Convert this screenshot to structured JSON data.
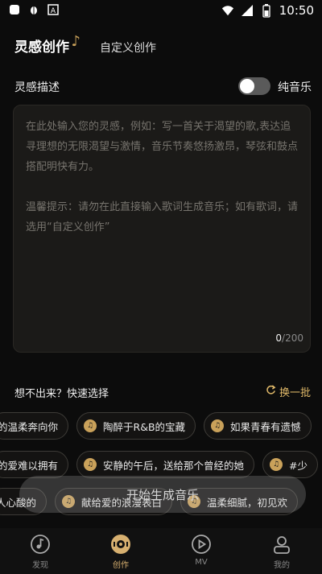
{
  "status_bar": {
    "time": "10:50",
    "left_icons": [
      "app-icon",
      "bug-icon",
      "font-icon"
    ],
    "right_icons": [
      "wifi-icon",
      "signal-icon",
      "battery-icon"
    ]
  },
  "tabs": {
    "active": "灵感创作",
    "inactive": "自定义创作"
  },
  "description": {
    "label": "灵感描述",
    "toggle_label": "纯音乐",
    "toggle_on": false,
    "placeholder": "在此处输入您的灵感，例如：写一首关于渴望的歌,表达追寻理想的无限渴望与激情，音乐节奏悠扬激昂，琴弦和鼓点搭配明快有力。\n\n温馨提示：请勿在此直接输入歌词生成音乐；如有歌词，请选用“自定义创作”",
    "count": "0",
    "max": "/200"
  },
  "quick_pick": {
    "label": "想不出来？快速选择",
    "refresh_label": "换一批",
    "row1": [
      "的温柔奔向你",
      "陶醉于R&B的宝藏",
      "如果青春有遗憾"
    ],
    "row2": [
      "的爱难以拥有",
      "安静的午后，送给那个曾经的她",
      "#少"
    ],
    "row3": [
      "人心酸的",
      "献给爱的浪漫表白",
      "温柔细腻，初见欢"
    ]
  },
  "generate_button": "开始生成音乐",
  "nav": [
    {
      "label": "发现",
      "icon": "music-note-icon"
    },
    {
      "label": "创作",
      "icon": "vinyl-icon"
    },
    {
      "label": "MV",
      "icon": "play-icon"
    },
    {
      "label": "我的",
      "icon": "user-icon"
    }
  ],
  "colors": {
    "accent": "#c9a15a",
    "background": "#0c0c0c"
  }
}
